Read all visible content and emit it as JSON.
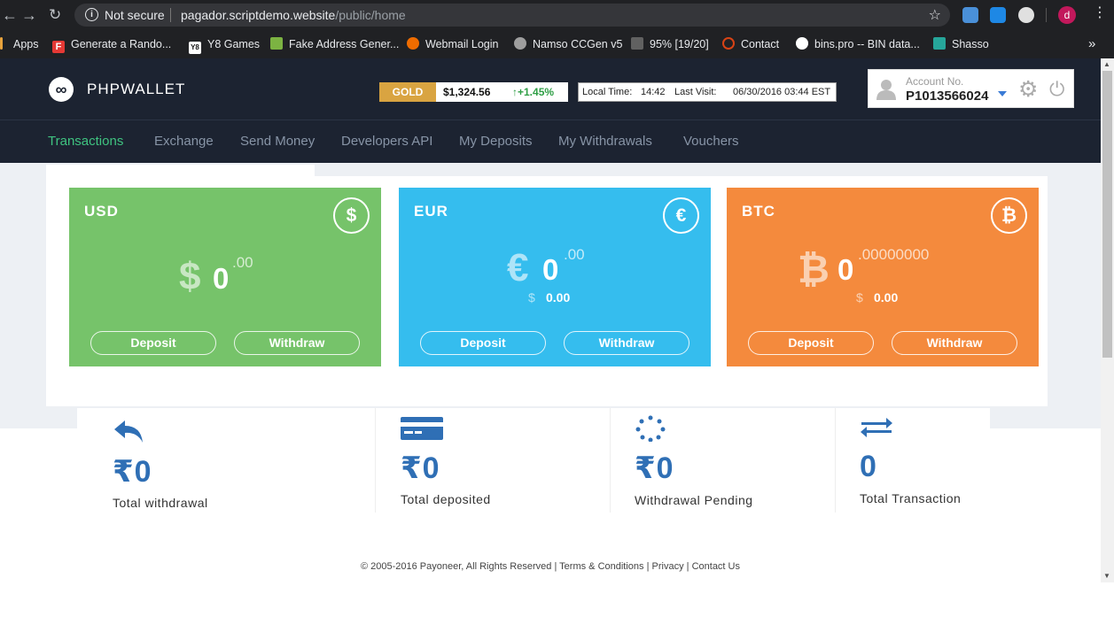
{
  "browser": {
    "security_label": "Not secure",
    "url_host": "pagador.scriptdemo.website",
    "url_path": "/public/home",
    "profile_initial": "d",
    "bookmarks": [
      {
        "label": "Apps"
      },
      {
        "label": "Generate a Rando..."
      },
      {
        "label": "Y8 Games"
      },
      {
        "label": "Fake Address Gener..."
      },
      {
        "label": "Webmail Login"
      },
      {
        "label": "Namso CCGen v5"
      },
      {
        "label": "95% [19/20]"
      },
      {
        "label": "Contact"
      },
      {
        "label": "bins.pro -- BIN data..."
      },
      {
        "label": "Shasso"
      }
    ],
    "bookmarks_overflow": "»"
  },
  "header": {
    "logo_text": "PHPWALLET",
    "ticker": {
      "tag": "GOLD",
      "price": "$1,324.56",
      "change": "+1.45%"
    },
    "local_time_label": "Local Time:",
    "local_time": "14:42",
    "last_visit_label": "Last Visit:",
    "last_visit": "06/30/2016 03:44 EST",
    "account_label": "Account No.",
    "account_no": "P1013566024"
  },
  "nav": {
    "items": [
      {
        "label": "Transactions",
        "active": true
      },
      {
        "label": "Exchange"
      },
      {
        "label": "Send Money"
      },
      {
        "label": "Developers API"
      },
      {
        "label": "My Deposits"
      },
      {
        "label": "My Withdrawals"
      },
      {
        "label": "Vouchers"
      }
    ]
  },
  "wallets": [
    {
      "currency": "USD",
      "symbol": "$",
      "amount": "0",
      "decimals": ".00",
      "deposit_label": "Deposit",
      "withdraw_label": "Withdraw",
      "color": "#76c36a"
    },
    {
      "currency": "EUR",
      "symbol": "€",
      "amount": "0",
      "decimals": ".00",
      "usd_symbol": "$",
      "usd_value": "0.00",
      "deposit_label": "Deposit",
      "withdraw_label": "Withdraw",
      "color": "#35bdee"
    },
    {
      "currency": "BTC",
      "symbol": "₿",
      "amount": "0",
      "decimals": ".00000000",
      "usd_symbol": "$",
      "usd_value": "0.00",
      "deposit_label": "Deposit",
      "withdraw_label": "Withdraw",
      "color": "#f48a3d"
    }
  ],
  "stats": [
    {
      "value": "₹0",
      "label": "Total withdrawal",
      "icon": "reply-arrow-icon"
    },
    {
      "value": "₹0",
      "label": "Total deposited",
      "icon": "credit-card-icon"
    },
    {
      "value": "₹0",
      "label": "Withdrawal Pending",
      "icon": "spinner-icon"
    },
    {
      "value": "0",
      "label": "Total Transaction",
      "icon": "exchange-arrows-icon"
    }
  ],
  "footer": {
    "copyright": "© 2005-2016 Payoneer, All Rights Reserved |",
    "terms": "Terms & Conditions",
    "sep1": "|",
    "privacy": "Privacy",
    "sep2": "|",
    "contact": "Contact Us"
  }
}
